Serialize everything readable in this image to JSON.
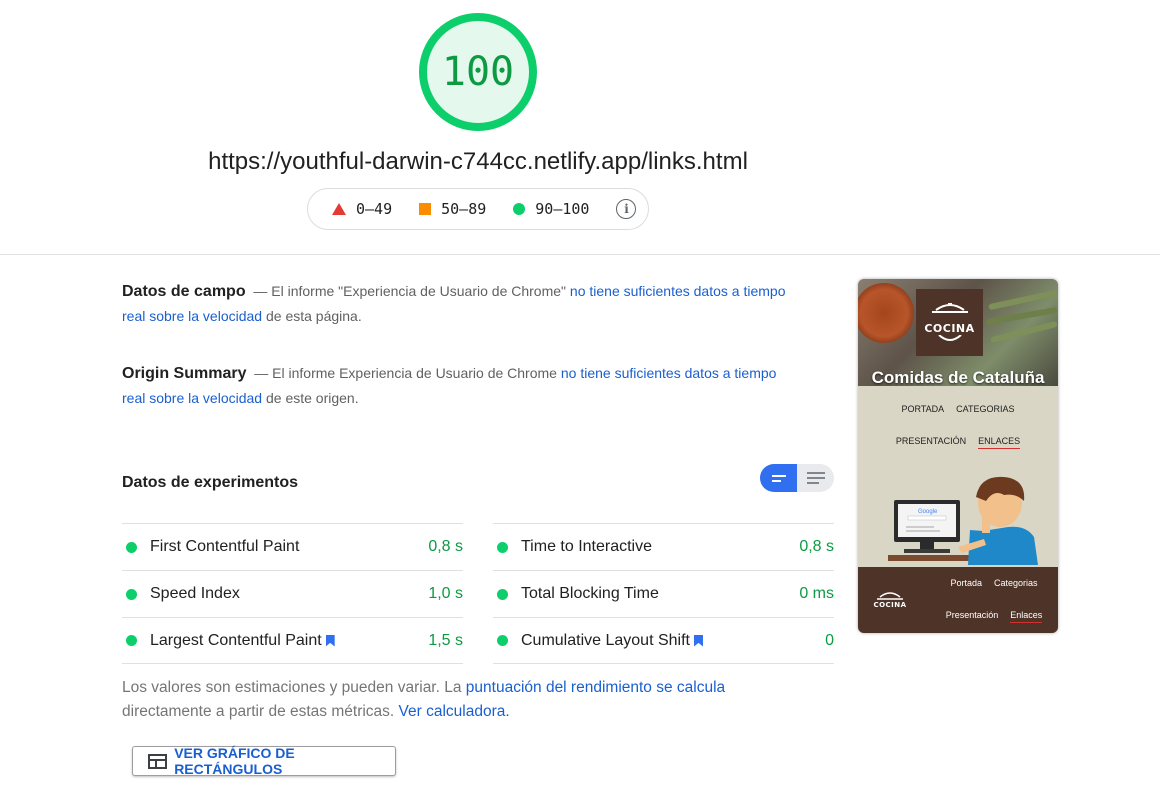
{
  "header": {
    "score": "100",
    "score_fraction": 1.0,
    "url": "https://youthful-darwin-c744cc.netlify.app/links.html",
    "legend": [
      {
        "shape": "triangle",
        "color": "#e53935",
        "label": "0–49"
      },
      {
        "shape": "square",
        "color": "#fb8c00",
        "label": "50–89"
      },
      {
        "shape": "circle",
        "color": "#0cce6b",
        "label": "90–100"
      }
    ],
    "info_icon": "info-icon"
  },
  "field_data": {
    "title": "Datos de campo",
    "dash": "—",
    "text_before": "El informe \"Experiencia de Usuario de Chrome\"",
    "link": "no tiene suficientes datos a tiempo real sobre la velocidad",
    "text_after": "de esta página."
  },
  "origin_summary": {
    "title": "Origin Summary",
    "dash": "—",
    "text_before": "El informe Experiencia de Usuario de Chrome",
    "link": "no tiene suficientes datos a tiempo real sobre la velocidad",
    "text_after": "de este origen."
  },
  "lab_data": {
    "title": "Datos de experimentos",
    "metrics_left": [
      {
        "name": "First Contentful Paint",
        "value": "0,8 s",
        "bookmark": false
      },
      {
        "name": "Speed Index",
        "value": "1,0 s",
        "bookmark": false
      },
      {
        "name": "Largest Contentful Paint",
        "value": "1,5 s",
        "bookmark": true
      }
    ],
    "metrics_right": [
      {
        "name": "Time to Interactive",
        "value": "0,8 s",
        "bookmark": false
      },
      {
        "name": "Total Blocking Time",
        "value": "0 ms",
        "bookmark": false
      },
      {
        "name": "Cumulative Layout Shift",
        "value": "0",
        "bookmark": true
      }
    ],
    "status_color": "#0cce6b"
  },
  "footnote": {
    "text1": "Los valores son estimaciones y pueden variar. La",
    "link1": "puntuación del rendimiento se calcula",
    "text2": "directamente a partir de estas métricas.",
    "link2": "Ver calculadora."
  },
  "treemap_button": {
    "label": "VER GRÁFICO DE RECTÁNGULOS"
  },
  "thumbnail": {
    "logo": "COCINA",
    "site_title": "Comidas de Cataluña",
    "nav_row1": [
      "PORTADA",
      "CATEGORIAS"
    ],
    "nav_row2": [
      "PRESENTACIÓN",
      "ENLACES"
    ],
    "footer_row1": [
      "Portada",
      "Categorias"
    ],
    "footer_row2": [
      "Presentación",
      "Enlaces"
    ],
    "search_logo": "Google"
  }
}
